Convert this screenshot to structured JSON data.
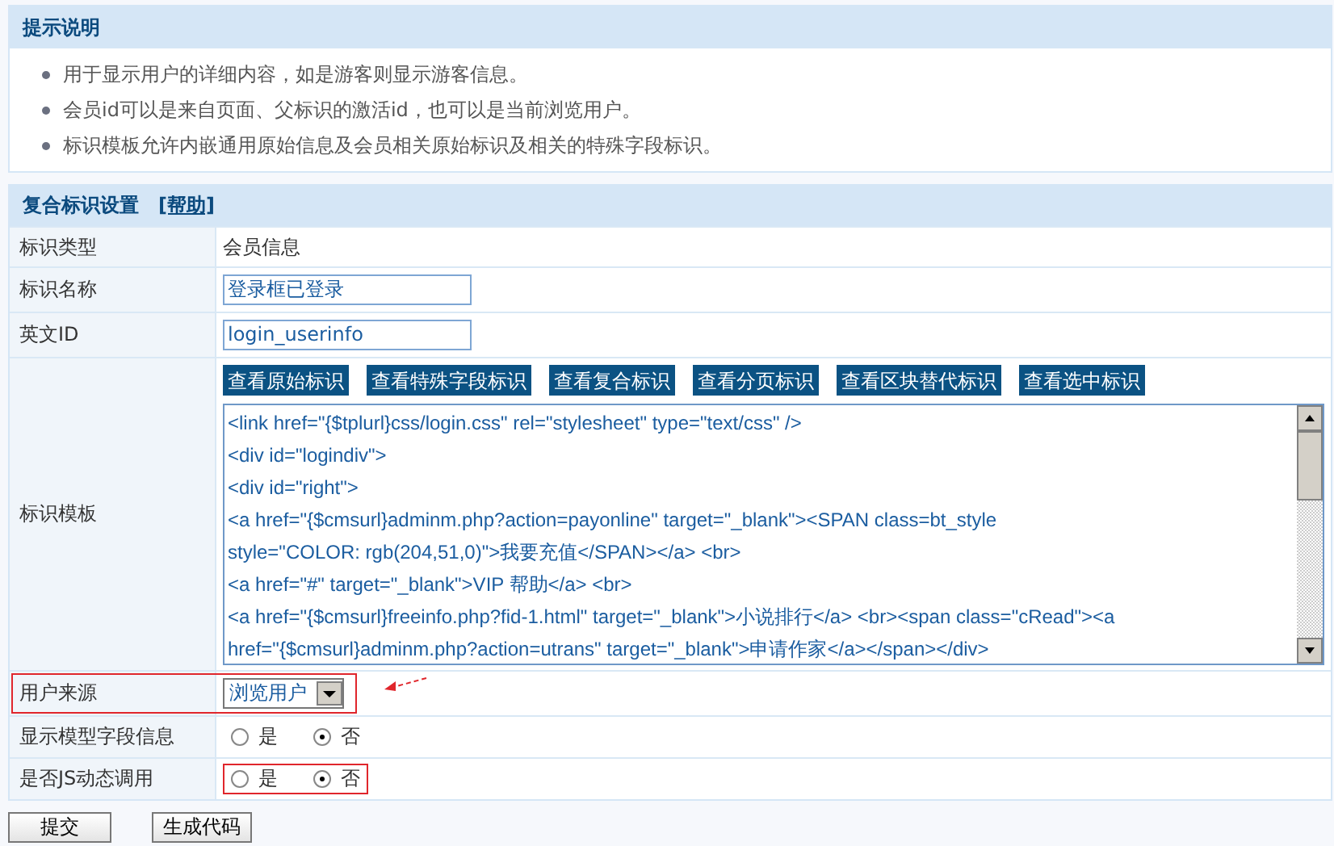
{
  "notes_panel": {
    "title": "提示说明",
    "items": [
      "用于显示用户的详细内容，如是游客则显示游客信息。",
      "会员id可以是来自页面、父标识的激活id，也可以是当前浏览用户。",
      "标识模板允许内嵌通用原始信息及会员相关原始标识及相关的特殊字段标识。"
    ]
  },
  "settings": {
    "title": "复合标识设置",
    "help_link": "[帮助]",
    "rows": [
      {
        "kind": "text",
        "label": "标识类型",
        "value": "会员信息",
        "highlighted": false
      },
      {
        "kind": "input",
        "label": "标识名称",
        "value": "登录框已登录",
        "highlighted": false
      },
      {
        "kind": "input",
        "label": "英文ID",
        "value": "login_userinfo",
        "highlighted": false
      },
      {
        "kind": "template",
        "label": "标识模板",
        "highlighted": false,
        "buttons": [
          "查看原始标识",
          "查看特殊字段标识",
          "查看复合标识",
          "查看分页标识",
          "查看区块替代标识",
          "查看选中标识"
        ],
        "code_lines": [
          "<link href=\"{$tplurl}css/login.css\" rel=\"stylesheet\" type=\"text/css\" />",
          "<div id=\"logindiv\">",
          "<div id=\"right\">",
          "<a href=\"{$cmsurl}adminm.php?action=payonline\" target=\"_blank\"><SPAN class=bt_style",
          "style=\"COLOR: rgb(204,51,0)\">我要充值</SPAN></a> <br>",
          "<a href=\"#\" target=\"_blank\">VIP 帮助</a> <br>",
          "<a href=\"{$cmsurl}freeinfo.php?fid-1.html\" target=\"_blank\">小说排行</a> <br><span class=\"cRead\"><a",
          "href=\"{$cmsurl}adminm.php?action=utrans\" target=\"_blank\">申请作家</a></span></div>"
        ]
      },
      {
        "kind": "select",
        "label": "用户来源",
        "value": "浏览用户",
        "highlighted": true
      },
      {
        "kind": "radio",
        "label": "显示模型字段信息",
        "highlighted": false,
        "options": [
          {
            "label": "是",
            "selected": false
          },
          {
            "label": "否",
            "selected": true
          }
        ]
      },
      {
        "kind": "radio",
        "label": "是否JS动态调用",
        "highlighted": true,
        "options": [
          {
            "label": "是",
            "selected": false
          },
          {
            "label": "否",
            "selected": true
          }
        ]
      }
    ]
  },
  "buttons": [
    "提交",
    "生成代码"
  ]
}
